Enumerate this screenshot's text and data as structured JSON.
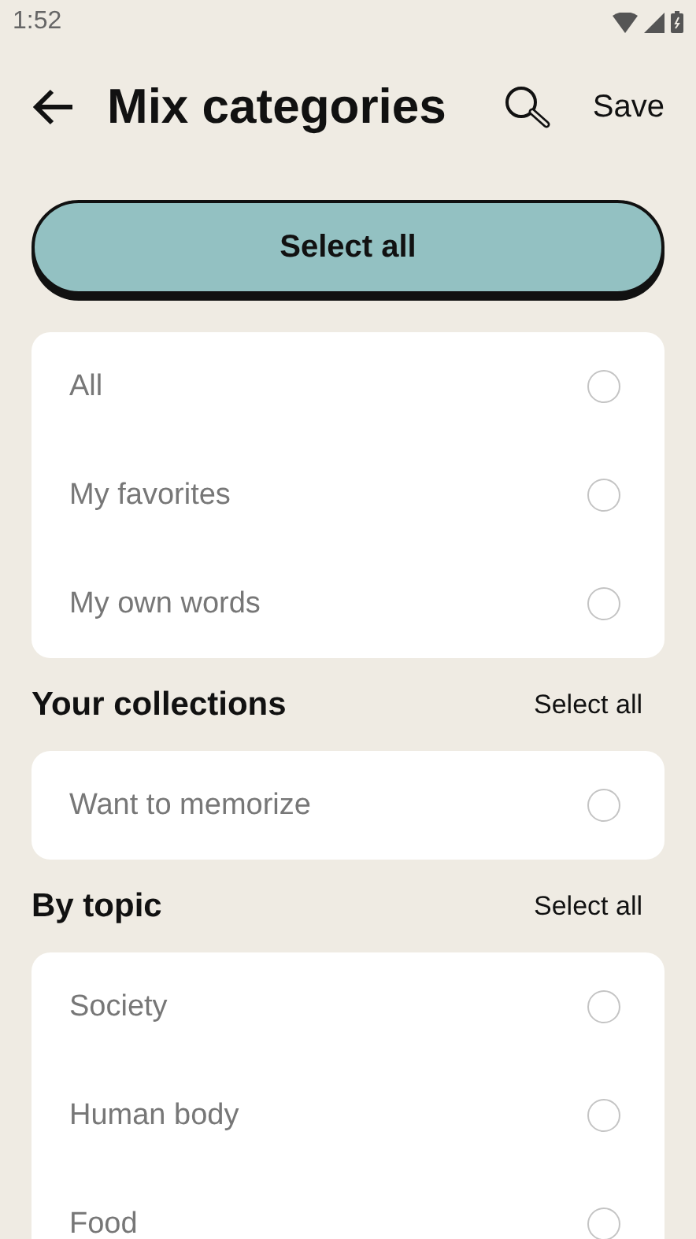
{
  "status_bar": {
    "time": "1:52"
  },
  "header": {
    "title": "Mix categories",
    "action": "Save"
  },
  "select_all_button": {
    "label": "Select all"
  },
  "sections": [
    {
      "rows": [
        {
          "label": "All",
          "selected": false
        },
        {
          "label": "My favorites",
          "selected": false
        },
        {
          "label": "My own words",
          "selected": false
        }
      ]
    },
    {
      "title": "Your collections",
      "select_all": "Select all",
      "rows": [
        {
          "label": "Want to memorize",
          "selected": false
        }
      ]
    },
    {
      "title": "By topic",
      "select_all": "Select all",
      "rows": [
        {
          "label": "Society",
          "selected": false
        },
        {
          "label": "Human body",
          "selected": false
        },
        {
          "label": "Food",
          "selected": false
        }
      ]
    }
  ]
}
